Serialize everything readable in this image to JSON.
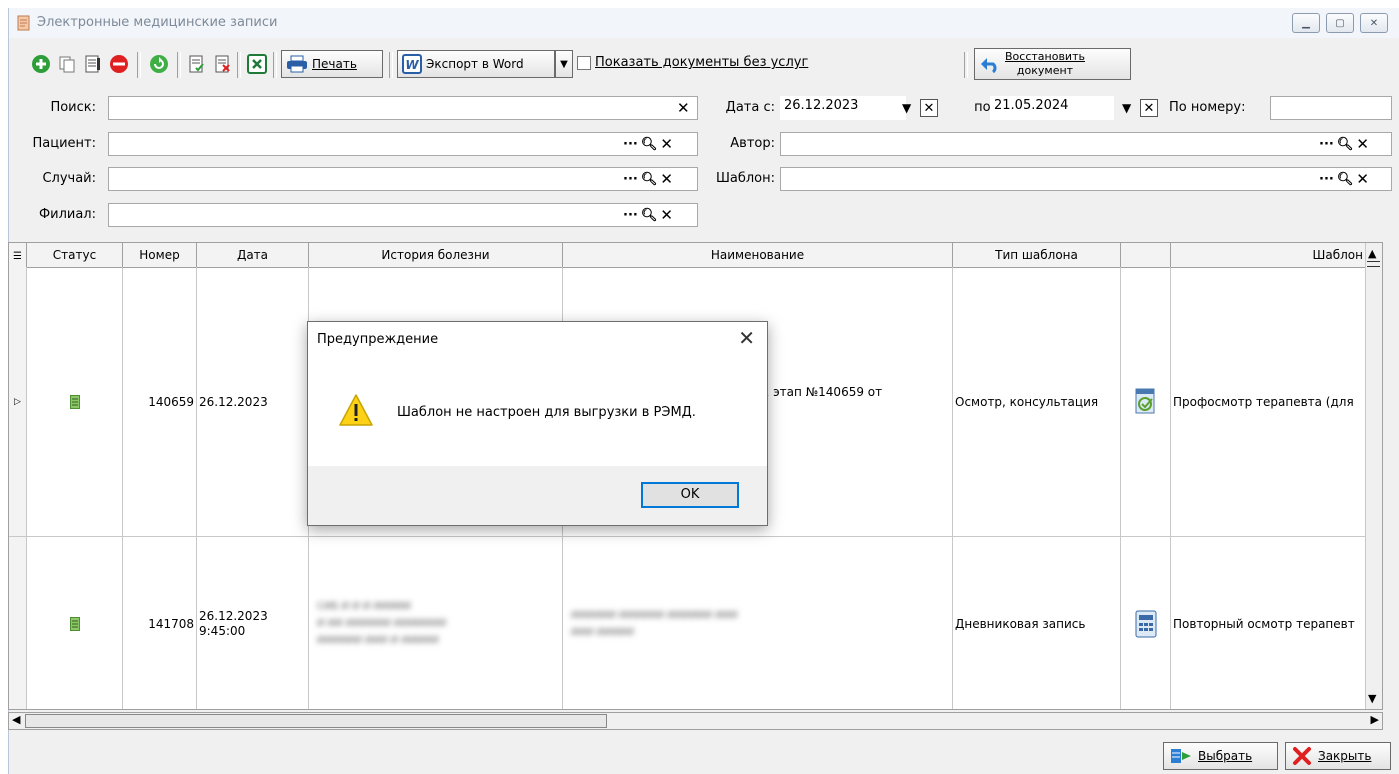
{
  "window": {
    "title": "Электронные медицинские записи"
  },
  "toolbar": {
    "print_label": "Печать",
    "export_label": "Экспорт в Word",
    "show_docs_label": "Показать документы без услуг",
    "restore_label_1": "Восстановить",
    "restore_label_2": "документ"
  },
  "filters": {
    "search_label": "Поиск:",
    "search_value": "",
    "date_from_label": "Дата с:",
    "date_from_value": "26.12.2023",
    "date_to_label": "по:",
    "date_to_value": "21.05.2024",
    "by_number_label": "По номеру:",
    "by_number_value": "",
    "patient_label": "Пациент:",
    "patient_value": "",
    "author_label": "Автор:",
    "author_value": "",
    "case_label": "Случай:",
    "case_value": "",
    "template_label": "Шаблон:",
    "template_value": "",
    "branch_label": "Филиал:",
    "branch_value": "",
    "ellipsis": "···"
  },
  "grid": {
    "columns": [
      "Статус",
      "Номер",
      "Дата",
      "История болезни",
      "Наименование",
      "Тип шаблона",
      "",
      "Шаблон"
    ],
    "rows": [
      {
        "number": "140659",
        "date": "26.12.2023",
        "history": "",
        "name": "ия, 1 этап №140659 от",
        "type": "Осмотр, консультация",
        "template": "Профосмотр терапевта (для"
      },
      {
        "number": "141708",
        "date_line1": "26.12.2023",
        "date_line2": "9:45:00",
        "history_blur_1": "СИБ И И И ИИИИИ",
        "history_blur_2": "И ИИ ИИИИИИ ИИИИИИИ",
        "history_blur_3": "ИИИИИИ ИИИ И ИИИИИ",
        "name_blur_1": "ИИИИИИ ИИИИИИ ИИИИИИ ИИИ",
        "name_blur_2": "ИИИ ИИИИИ",
        "type": "Дневниковая запись",
        "template": "Повторный осмотр терапевт"
      }
    ]
  },
  "dialog": {
    "title": "Предупреждение",
    "message": "Шаблон не настроен для выгрузки в РЭМД.",
    "ok_label": "OK"
  },
  "bottom": {
    "select_label": "Выбрать",
    "close_label": "Закрыть"
  },
  "colors": {
    "accent": "#0078d7",
    "add_green": "#2e9e3a",
    "delete_red": "#e02020",
    "doc_green": "#6ab04c"
  }
}
